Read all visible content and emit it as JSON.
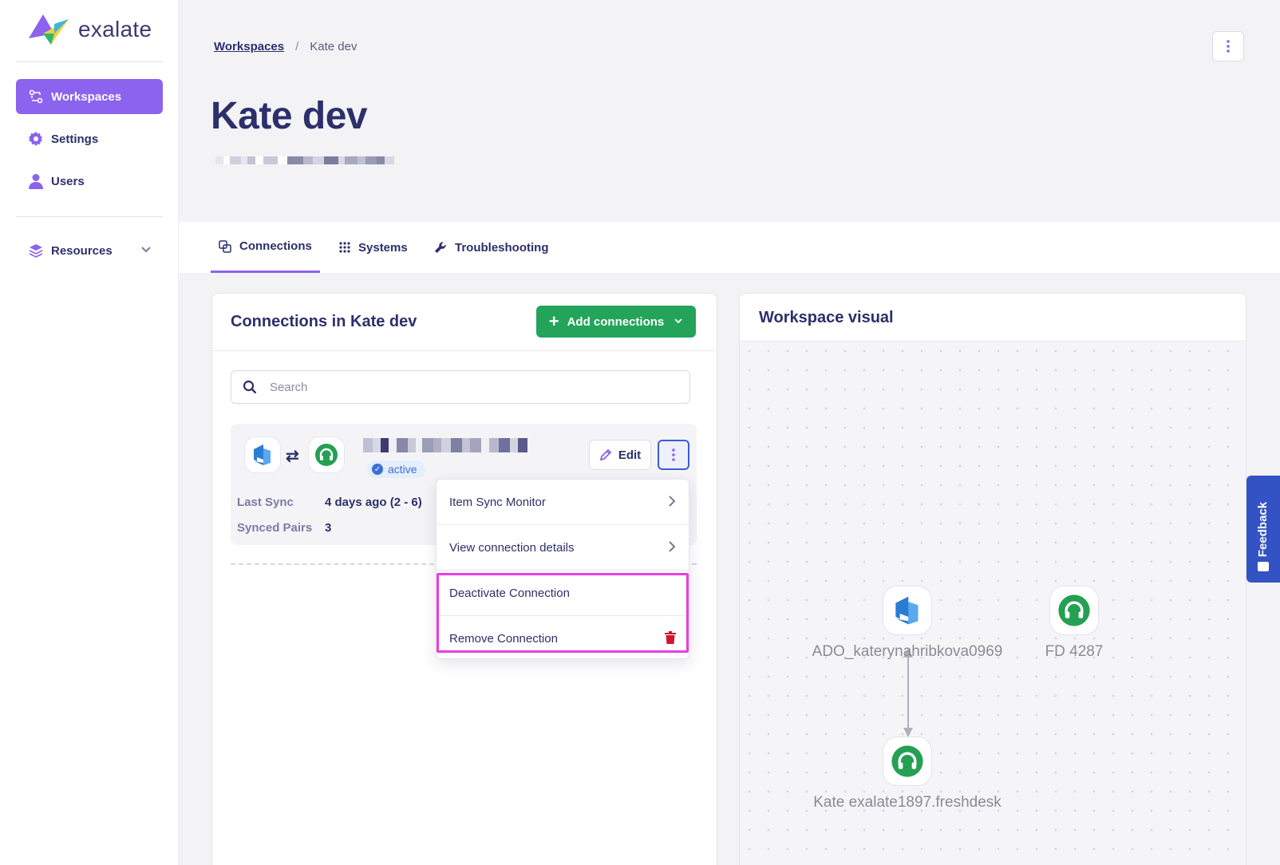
{
  "brand": {
    "name": "exalate"
  },
  "sidebar": {
    "items": [
      {
        "label": "Workspaces",
        "icon": "workspaces-icon",
        "active": true
      },
      {
        "label": "Settings",
        "icon": "gear-icon"
      },
      {
        "label": "Users",
        "icon": "user-icon"
      },
      {
        "label": "Resources",
        "icon": "layers-icon"
      }
    ]
  },
  "breadcrumb": {
    "parent": "Workspaces",
    "separator": "/",
    "current": "Kate dev"
  },
  "page": {
    "title": "Kate dev"
  },
  "tabs": [
    {
      "label": "Connections",
      "icon": "connections-icon",
      "active": true
    },
    {
      "label": "Systems",
      "icon": "grid-icon"
    },
    {
      "label": "Troubleshooting",
      "icon": "wrench-icon"
    }
  ],
  "connections_panel": {
    "title": "Connections in Kate dev",
    "add_button": "Add connections",
    "search_placeholder": "Search",
    "connection": {
      "status": "active",
      "edit_label": "Edit",
      "last_sync_label": "Last Sync",
      "last_sync_value": "4 days ago (2 - 6)",
      "synced_pairs_label": "Synced Pairs",
      "synced_pairs_value": "3"
    }
  },
  "menu": {
    "items": [
      {
        "label": "Item Sync Monitor"
      },
      {
        "label": "View connection details"
      },
      {
        "label": "Deactivate Connection"
      },
      {
        "label": "Remove Connection"
      }
    ]
  },
  "visual_panel": {
    "title": "Workspace visual",
    "nodes": [
      {
        "label": "ADO_katerynahribkova0969",
        "type": "azure-devops-icon"
      },
      {
        "label": "FD 4287",
        "type": "freshdesk-icon"
      },
      {
        "label": "Kate exalate1897.freshdesk",
        "type": "freshdesk-icon"
      }
    ]
  },
  "feedback": {
    "label": "Feedback"
  },
  "colors": {
    "accent": "#8b63ee",
    "primary_text": "#2d2f6b",
    "add_button": "#23a45a",
    "highlight": "#e83fe0",
    "delete": "#d0142c",
    "feedback": "#3352c4"
  }
}
